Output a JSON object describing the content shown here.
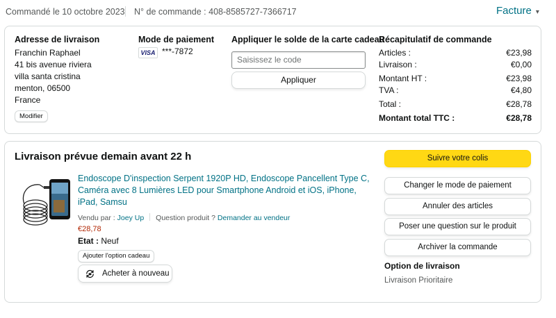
{
  "header": {
    "ordered_on": "Commandé le 10 octobre 2023",
    "order_number": "N° de commande : 408-8585727-7366717",
    "invoice": "Facture"
  },
  "shipping_address": {
    "title": "Adresse de livraison",
    "lines": [
      "Franchin Raphael",
      "41 bis avenue riviera",
      "villa santa cristina",
      "menton, 06500",
      "France"
    ],
    "modify_label": "Modifier"
  },
  "payment": {
    "title": "Mode de paiement",
    "card_brand": "VISA",
    "card_number": "***-7872"
  },
  "gift_card": {
    "title": "Appliquer le solde de la carte cadeau",
    "placeholder": "Saisissez le code",
    "apply_label": "Appliquer"
  },
  "summary": {
    "title": "Récapitulatif de commande",
    "rows": [
      {
        "label": "Articles :",
        "value": "€23,98"
      },
      {
        "label": "Livraison :",
        "value": "€0,00"
      },
      {
        "label": "Montant HT :",
        "value": "€23,98"
      },
      {
        "label": "TVA :",
        "value": "€4,80"
      },
      {
        "label": "Total :",
        "value": "€28,78"
      },
      {
        "label": "Montant total TTC :",
        "value": "€28,78"
      }
    ]
  },
  "delivery": {
    "title": "Livraison prévue demain avant 22 h",
    "product": {
      "title": "Endoscope D'inspection Serpent 1920P HD, Endoscope Pancellent Type C, Caméra avec 8 Lumières LED pour Smartphone Android et iOS, iPhone, iPad, Samsu",
      "seller_prefix": "Vendu par : ",
      "seller_name": "Joey Up",
      "question_prefix": "Question produit ? ",
      "question_link": "Demander au vendeur",
      "price": "€28,78",
      "state_label": "Etat :",
      "state_value": "Neuf",
      "gift_option_label": "Ajouter l'option cadeau",
      "buy_again_label": "Acheter à nouveau"
    },
    "actions": {
      "track": "Suivre votre colis",
      "change_payment": "Changer le mode de paiement",
      "cancel": "Annuler des articles",
      "ask_question": "Poser une question sur le produit",
      "archive": "Archiver la commande"
    },
    "option_title": "Option de livraison",
    "option_value": "Livraison Prioritaire"
  },
  "colors": {
    "link": "#007185",
    "primary_button": "#ffd814",
    "price": "#b12704",
    "border": "#d5d9d9"
  }
}
